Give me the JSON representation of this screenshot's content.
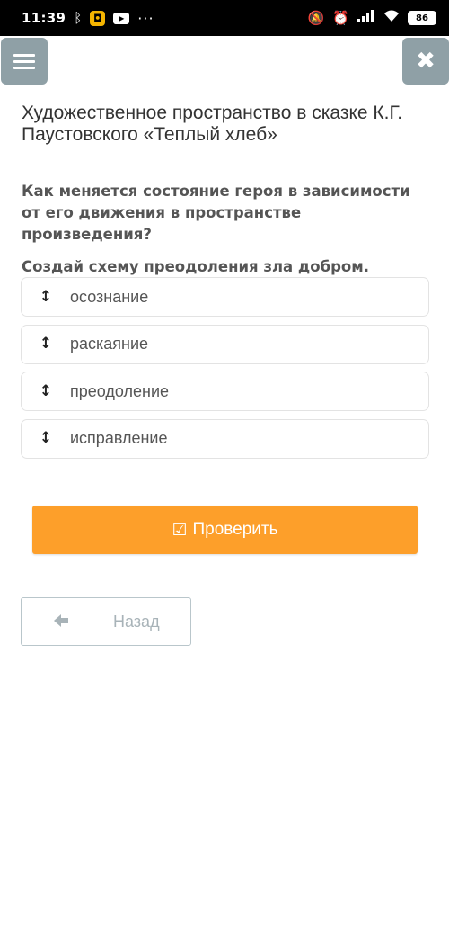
{
  "status_bar": {
    "time": "11:39",
    "battery": "86",
    "left_icons": [
      "bluetooth-icon",
      "app-notification-icon",
      "youtube-icon",
      "more-dots-icon"
    ],
    "right_icons": [
      "mute-icon",
      "alarm-icon",
      "signal-icon",
      "wifi-icon",
      "battery-icon"
    ]
  },
  "toolbar": {
    "menu_icon": "hamburger-menu-icon",
    "close_icon": "close-icon",
    "menu_color": "#8fa0a6"
  },
  "lesson": {
    "title": "Художественное пространство в сказке К.Г. Паустовского «Теплый хлеб»",
    "question": "Как меняется состояние героя в зависимости от его движения в пространстве произведения?",
    "instruction": "Создай схему преодоления зла добром."
  },
  "ordering_items": [
    {
      "label": "осознание",
      "handle": "↕"
    },
    {
      "label": "раскаяние",
      "handle": "↕"
    },
    {
      "label": "преодоление",
      "handle": "↕"
    },
    {
      "label": "исправление",
      "handle": "↕"
    }
  ],
  "actions": {
    "check_label": "Проверить",
    "check_icon": "☑",
    "back_label": "Назад",
    "back_icon": "🡐",
    "accent_color": "#fd9f2a"
  }
}
